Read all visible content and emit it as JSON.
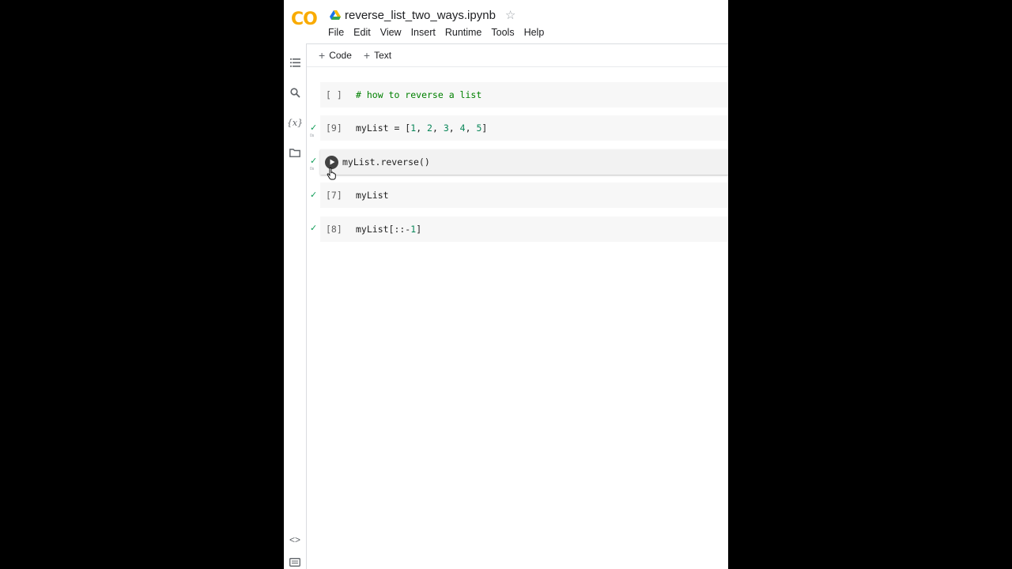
{
  "header": {
    "logo_text": "CO",
    "notebook_title": "reverse_list_two_ways.ipynb",
    "menu": [
      "File",
      "Edit",
      "View",
      "Insert",
      "Runtime",
      "Tools",
      "Help"
    ]
  },
  "toolbar": {
    "code_label": "Code",
    "text_label": "Text"
  },
  "rail_icons": [
    "toc-icon",
    "search-icon",
    "variables-icon",
    "folder-icon",
    "code-snippets-icon",
    "terminal-icon"
  ],
  "cells": [
    {
      "exec": "[ ]",
      "code": "# how to reverse a list",
      "status": "not-run"
    },
    {
      "exec": "[9]",
      "code": "myList = [1, 2, 3, 4, 5]",
      "status": "done",
      "time": "0s"
    },
    {
      "exec": "",
      "code": "myList.reverse()",
      "status": "done",
      "time": "0s",
      "active": true
    },
    {
      "exec": "[7]",
      "code": "myList",
      "status": "done"
    },
    {
      "exec": "[8]",
      "code": "myList[::-1]",
      "status": "done"
    }
  ],
  "colors": {
    "comment": "#008000",
    "number": "#098658",
    "check": "#0f9d58",
    "logo": "#f9ab00"
  }
}
